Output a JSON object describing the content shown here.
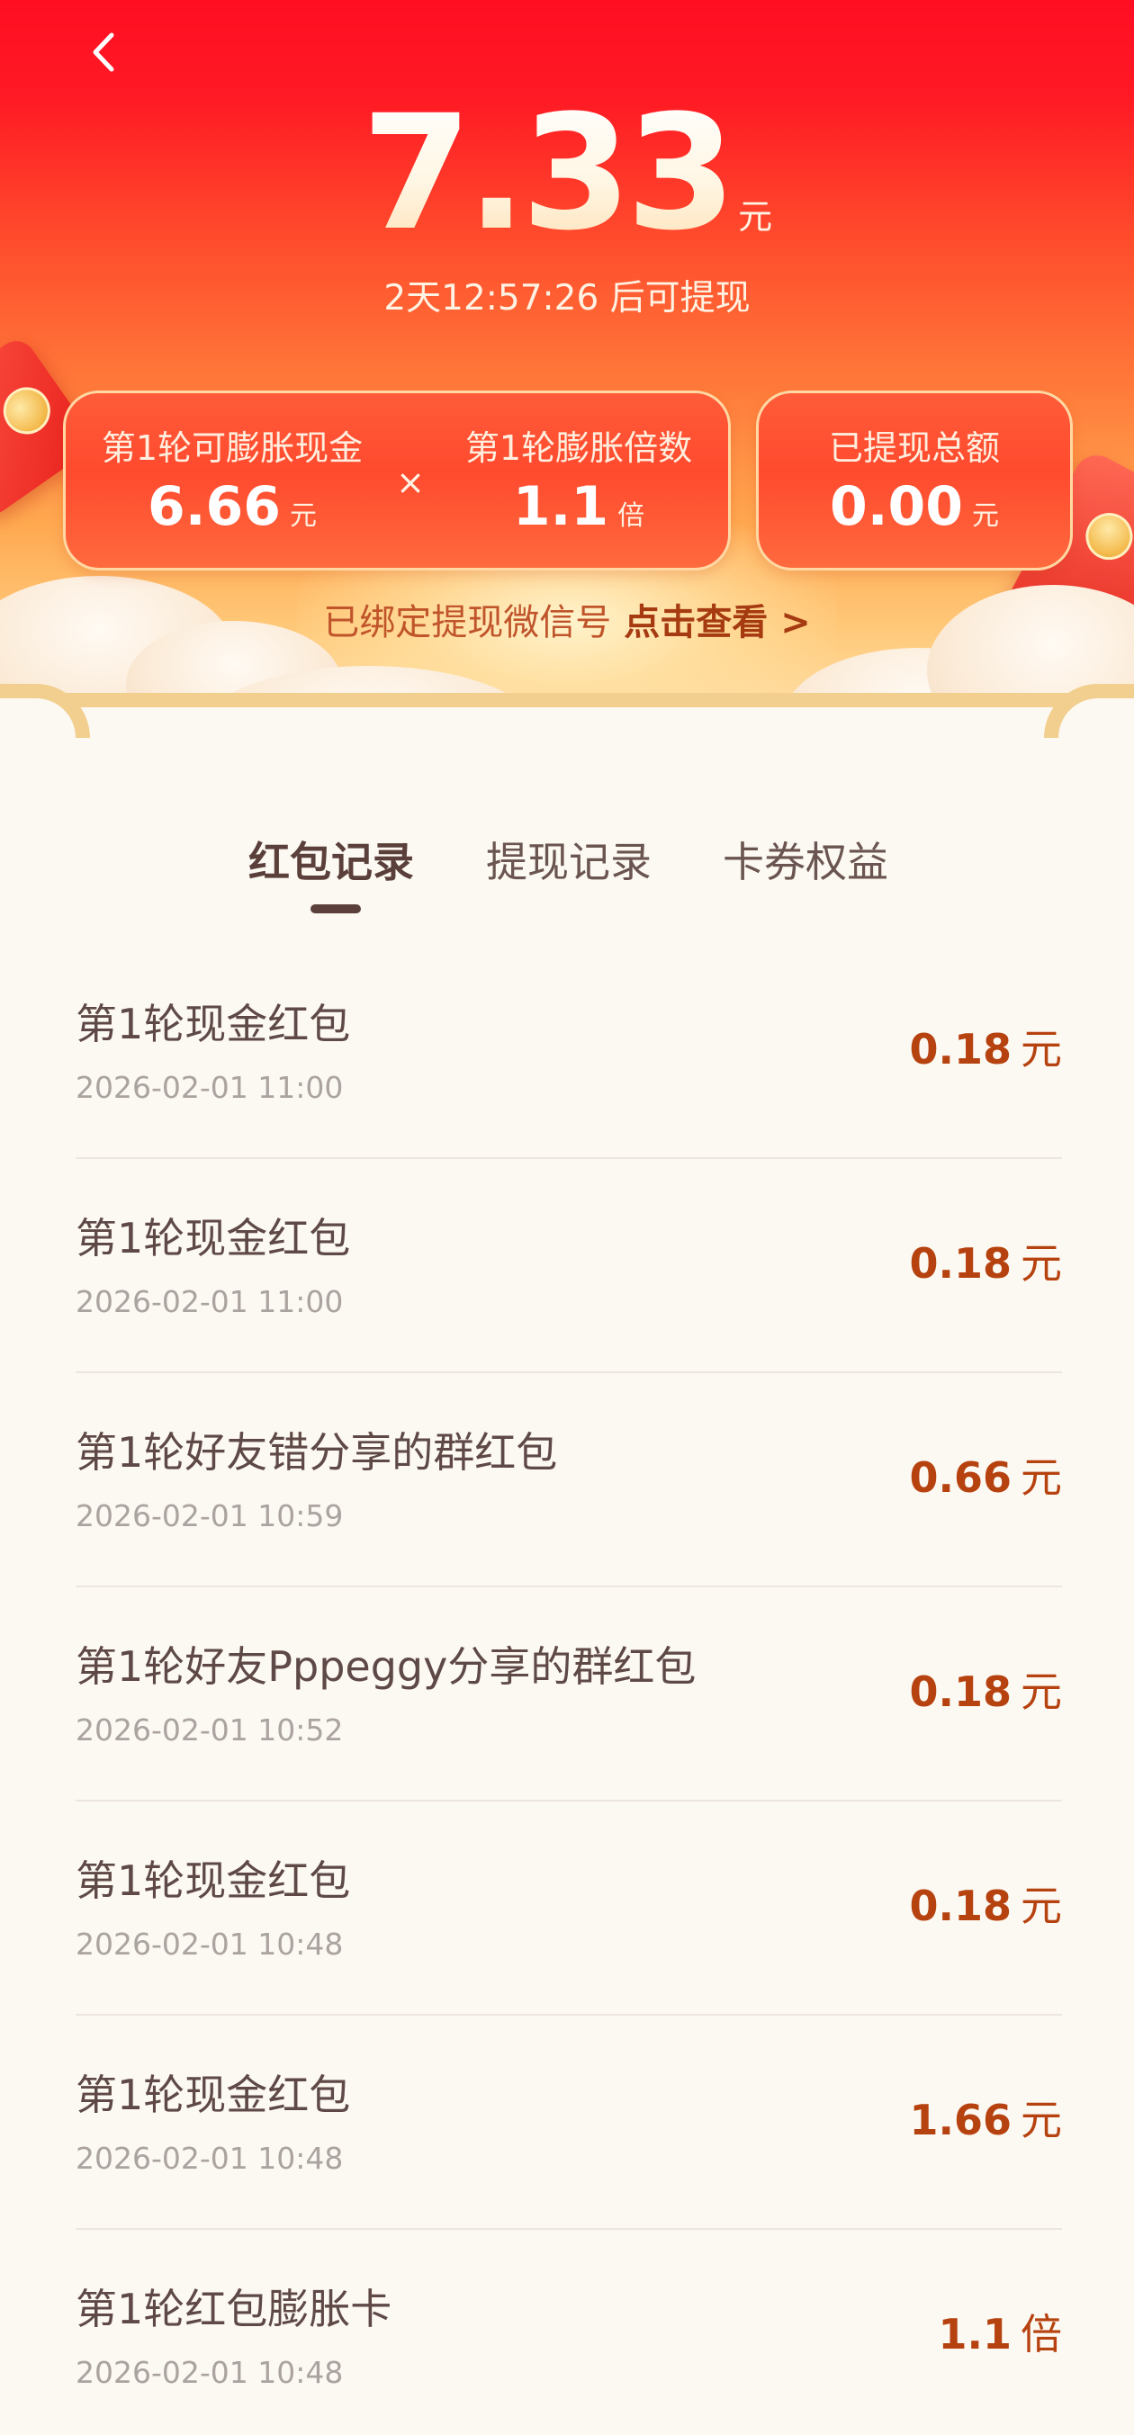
{
  "header": {
    "amount": "7.33",
    "amount_unit": "元",
    "countdown": "2天12:57:26 后可提现"
  },
  "stats": {
    "expandable_label": "第1轮可膨胀现金",
    "expandable_value": "6.66",
    "expandable_unit": "元",
    "operator": "×",
    "multiplier_label": "第1轮膨胀倍数",
    "multiplier_value": "1.1",
    "multiplier_unit": "倍",
    "withdrawn_label": "已提现总额",
    "withdrawn_value": "0.00",
    "withdrawn_unit": "元"
  },
  "bind": {
    "text": "已绑定提现微信号",
    "link": "点击查看 >"
  },
  "tabs": [
    {
      "label": "红包记录",
      "active": true
    },
    {
      "label": "提现记录",
      "active": false
    },
    {
      "label": "卡券权益",
      "active": false
    }
  ],
  "records": [
    {
      "title": "第1轮现金红包",
      "time": "2026-02-01 11:00",
      "amount": "0.18",
      "unit": "元"
    },
    {
      "title": "第1轮现金红包",
      "time": "2026-02-01 11:00",
      "amount": "0.18",
      "unit": "元"
    },
    {
      "title": "第1轮好友错分享的群红包",
      "time": "2026-02-01 10:59",
      "amount": "0.66",
      "unit": "元"
    },
    {
      "title": "第1轮好友Pppeggy分享的群红包",
      "time": "2026-02-01 10:52",
      "amount": "0.18",
      "unit": "元"
    },
    {
      "title": "第1轮现金红包",
      "time": "2026-02-01 10:48",
      "amount": "0.18",
      "unit": "元"
    },
    {
      "title": "第1轮现金红包",
      "time": "2026-02-01 10:48",
      "amount": "1.66",
      "unit": "元"
    },
    {
      "title": "第1轮红包膨胀卡",
      "time": "2026-02-01 10:48",
      "amount": "1.1",
      "unit": "倍"
    }
  ],
  "icons": {
    "back": "chevron-left-icon",
    "decoration_left": "red-envelope-icon",
    "decoration_right": "red-envelope-icon"
  },
  "colors": {
    "header_top": "#ff0e22",
    "header_bottom": "#ffc97a",
    "card_fill": "#ff4a2e",
    "amount_accent": "#b6420f",
    "link_accent": "#a63b12"
  }
}
